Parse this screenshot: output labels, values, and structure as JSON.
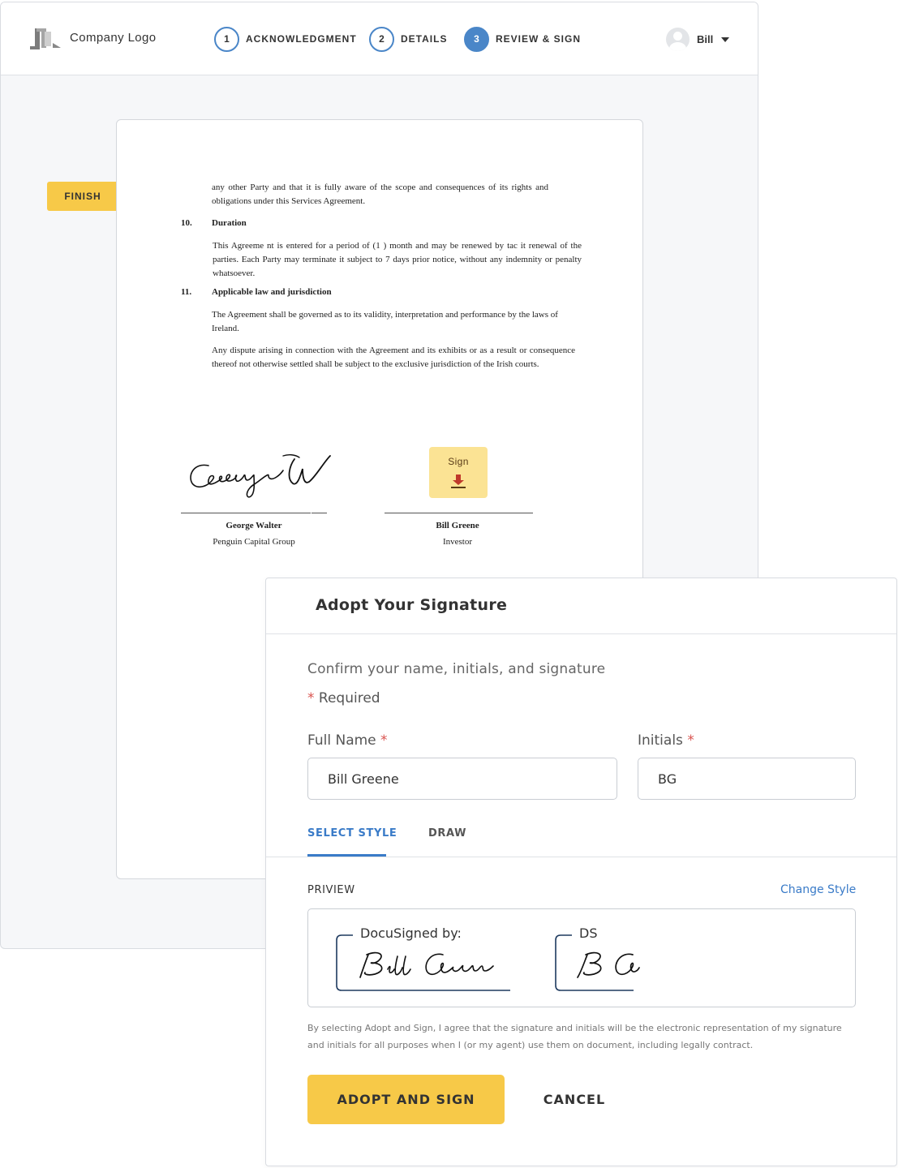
{
  "colors": {
    "accent_yellow": "#f7c948",
    "sign_tag_yellow": "#fbe394",
    "step_blue": "#4a86c8",
    "link_blue": "#3a7bc8",
    "required_red": "#d9534f"
  },
  "header": {
    "logo_icon": "company-logo-icon",
    "logo_text": "Company Logo",
    "steps": [
      {
        "number": "1",
        "label": "ACKNOWLEDGMENT",
        "active": false
      },
      {
        "number": "2",
        "label": "DETAILS",
        "active": false
      },
      {
        "number": "3",
        "label": "REVIEW & SIGN",
        "active": true
      }
    ],
    "user": {
      "name": "Bill",
      "avatar_icon": "user-avatar-icon",
      "caret_icon": "caret-down-icon"
    }
  },
  "finish_label": "FINISH",
  "document": {
    "intro": "any other Party and that it is fully aware of the scope and consequences of its rights and obligations under this Services Agreement.",
    "sections": [
      {
        "number": "10.",
        "heading": "Duration",
        "paragraphs": [
          "This Agreeme nt is entered for a period of (1 ) month and may be renewed by tac it renewal of the parties. Each Party may terminate it subject to 7  days prior notice, without any indemnity or penalty whatsoever."
        ]
      },
      {
        "number": "11.",
        "heading": "Applicable law and jurisdiction",
        "paragraphs": [
          "The Agreement shall be governed as to its validity, interpretation and performance by the     laws of Ireland.",
          "Any dispute arising in connection with the Agreement and its exhibits or as a result or consequence thereof not otherwise settled shall be subject to the exclusive jurisdiction of the Irish courts."
        ]
      }
    ],
    "signers": [
      {
        "name": "George Walter",
        "org": "Penguin Capital Group",
        "signed": true
      },
      {
        "name": "Bill Greene",
        "org": "Investor",
        "signed": false
      }
    ],
    "sign_tag": {
      "label": "Sign",
      "icon": "download-arrow-icon"
    }
  },
  "modal": {
    "title": "Adopt Your Signature",
    "subtitle": "Confirm your name, initials, and signature",
    "required_marker": "*",
    "required_text": "Required",
    "full_name": {
      "label": "Full Name",
      "value": "Bill Greene"
    },
    "initials": {
      "label": "Initials",
      "value": "BG"
    },
    "tabs": [
      {
        "label": "SELECT STYLE",
        "active": true
      },
      {
        "label": "DRAW",
        "active": false
      }
    ],
    "preview_label": "PRIVIEW",
    "change_style": "Change Style",
    "signature_label": "DocuSigned by:",
    "initials_label": "DS",
    "legal_text": "By selecting Adopt and Sign, I agree that the signature and initials will be the electronic representation of my signature and initials for all purposes when I (or my agent) use them on document, including legally contract.",
    "adopt_button": "ADOPT AND SIGN",
    "cancel_button": "CANCEL"
  }
}
